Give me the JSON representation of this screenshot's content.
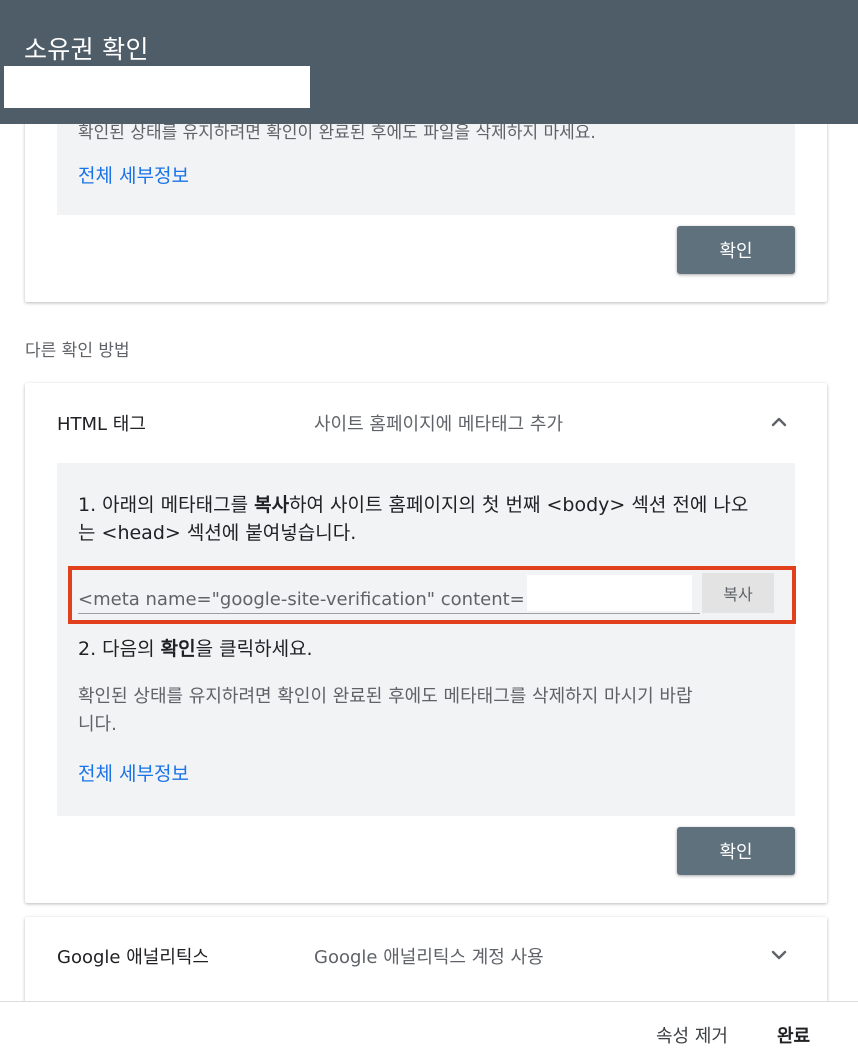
{
  "header": {
    "title": "소유권 확인"
  },
  "top_method": {
    "faded_note": "확인된 상태를 유지하려면 확인이 완료된 후에도 파일을 삭제하지 마세요.",
    "details_link": "전체 세부정보",
    "verify_button": "확인"
  },
  "other_methods": {
    "label": "다른 확인 방법"
  },
  "html_tag": {
    "title": "HTML 태그",
    "description": "사이트 홈페이지에 메타태그 추가",
    "step1_line1_pre": "1. 아래의 메타태그를 ",
    "step1_bold": "복사",
    "step1_line1_post": "하여 사이트 홈페이지의 첫 번째 <body> 섹션 전에 나오",
    "step1_line2": "는 <head> 섹션에 붙여넣습니다.",
    "meta_value": "<meta name=\"google-site-verification\" content=",
    "copy_button": "복사",
    "step2_pre": "2. 다음의 ",
    "step2_bold": "확인",
    "step2_post": "을 클릭하세요.",
    "note_line1": "확인된 상태를 유지하려면 확인이 완료된 후에도 메타태그를 삭제하지 마시기 바랍",
    "note_line2": "니다.",
    "details_link": "전체 세부정보",
    "verify_button": "확인"
  },
  "google_analytics": {
    "title": "Google 애널리틱스",
    "description": "Google 애널리틱스 계정 사용"
  },
  "footer": {
    "remove_property": "속성 제거",
    "done": "완료"
  },
  "colors": {
    "header_bg": "#4f5d68",
    "button_bg": "#5f717d",
    "link": "#1a73e8",
    "highlight_border": "#e2401d"
  }
}
